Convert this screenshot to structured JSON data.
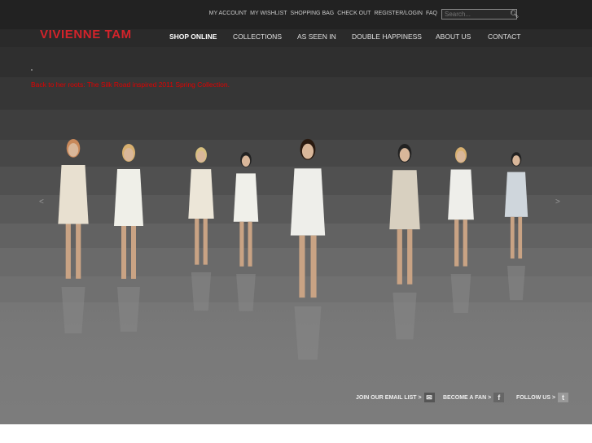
{
  "utility_links": [
    "MY ACCOUNT",
    "MY WISHLIST",
    "SHOPPING BAG",
    "CHECK OUT",
    "REGISTER/LOGIN",
    "FAQ"
  ],
  "search": {
    "placeholder": "Search..."
  },
  "brand": "VIVIENNE TAM",
  "nav": [
    "SHOP ONLINE",
    "COLLECTIONS",
    "AS SEEN IN",
    "DOUBLE HAPPINESS",
    "ABOUT US",
    "CONTACT"
  ],
  "caption": "Back to her roots: The Silk Road inspired 2011 Spring Collection.",
  "carousel": {
    "prev": "<",
    "next": ">"
  },
  "footer": {
    "email": "JOIN OUR EMAIL LIST >",
    "fan": "BECOME A FAN >",
    "follow": "FOLLOW US >"
  },
  "colors": {
    "brand": "#d3232a",
    "caption": "#e00000"
  }
}
